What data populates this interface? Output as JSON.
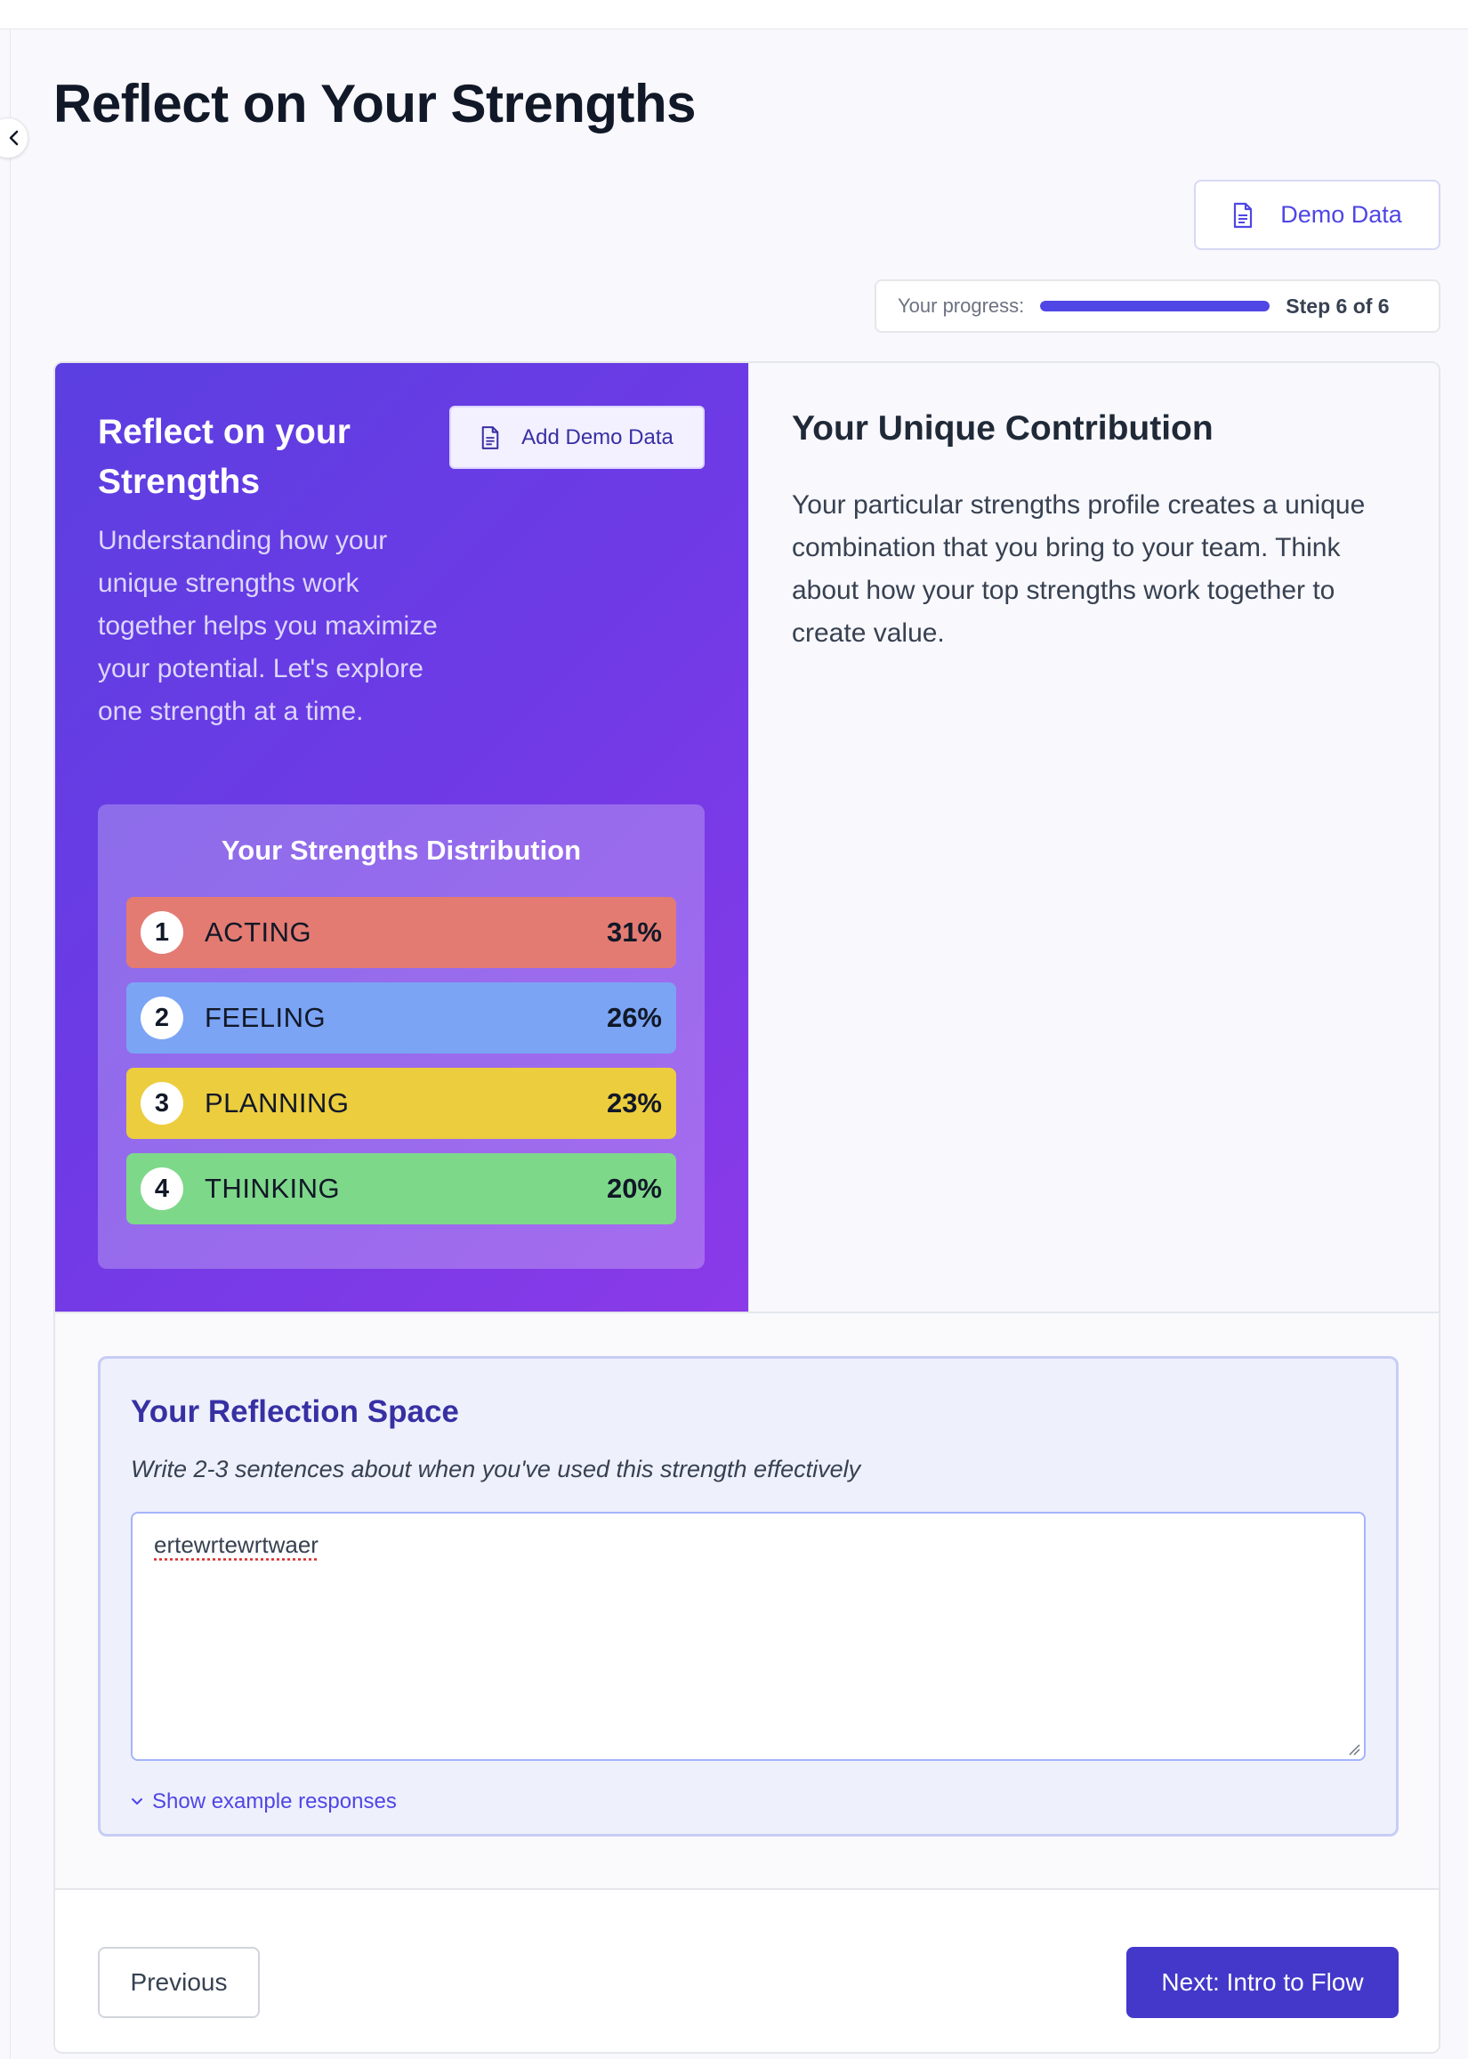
{
  "page": {
    "title": "Reflect on Your Strengths"
  },
  "header": {
    "demo_button_label": "Demo Data",
    "demo_button_icon": "document-icon"
  },
  "progress": {
    "label": "Your progress:",
    "step_text": "Step 6 of 6",
    "fraction": 1.0,
    "color": "#4f46e5"
  },
  "hero": {
    "title": "Reflect on your Strengths",
    "add_demo_label": "Add Demo Data",
    "description": "Understanding how your unique strengths work together helps you maximize your potential. Let's explore one strength at a time.",
    "distribution": {
      "title": "Your Strengths Distribution",
      "items": [
        {
          "rank": "1",
          "label": "ACTING",
          "percent": "31%",
          "color": "#e37b72"
        },
        {
          "rank": "2",
          "label": "FEELING",
          "percent": "26%",
          "color": "#7ba4f5"
        },
        {
          "rank": "3",
          "label": "PLANNING",
          "percent": "23%",
          "color": "#eccd3e"
        },
        {
          "rank": "4",
          "label": "THINKING",
          "percent": "20%",
          "color": "#7ed88a"
        }
      ]
    }
  },
  "contribution": {
    "title": "Your Unique Contribution",
    "text": "Your particular strengths profile creates a unique combination that you bring to your team. Think about how your top strengths work together to create value."
  },
  "reflection": {
    "title": "Your Reflection Space",
    "subtitle": "Write 2-3 sentences about when you've used this strength effectively",
    "value": "ertewrtewrtwaer",
    "show_examples_label": "Show example responses"
  },
  "footer": {
    "previous_label": "Previous",
    "next_label": "Next: Intro to Flow"
  }
}
